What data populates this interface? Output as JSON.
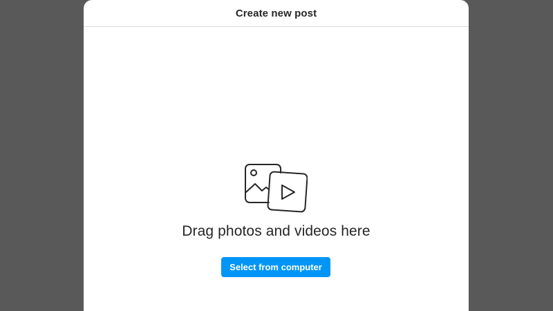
{
  "modal": {
    "title": "Create new post",
    "drag_text": "Drag photos and videos here",
    "select_button_label": "Select from computer",
    "icon": "photo-video-icon"
  },
  "colors": {
    "backdrop": "#595959",
    "modal_background": "#ffffff",
    "text": "#262626",
    "divider": "#dbdbdb",
    "button": "#0095f6",
    "button_text": "#ffffff"
  }
}
